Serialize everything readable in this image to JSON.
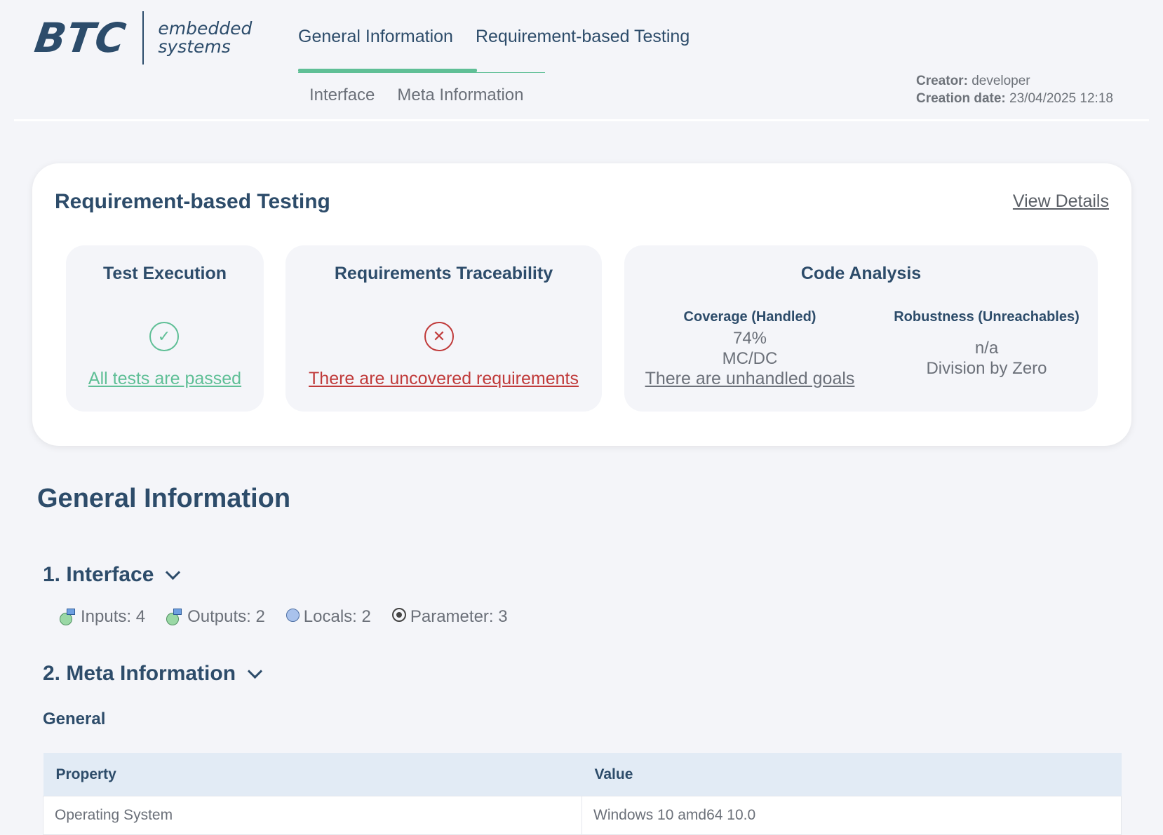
{
  "header": {
    "logo_brand": "BTC",
    "logo_line1": "embedded",
    "logo_line2": "systems",
    "nav_top": [
      "General Information",
      "Requirement-based Testing"
    ],
    "nav_sub": [
      "Interface",
      "Meta Information"
    ],
    "creator_label": "Creator:",
    "creator_value": "developer",
    "date_label": "Creation date:",
    "date_value": "23/04/2025 12:18"
  },
  "rbt": {
    "title": "Requirement-based Testing",
    "view_details": "View Details",
    "test_execution": {
      "title": "Test Execution",
      "status": "ok",
      "link": "All tests are passed"
    },
    "traceability": {
      "title": "Requirements Traceability",
      "status": "error",
      "link": "There are uncovered requirements"
    },
    "code_analysis": {
      "title": "Code Analysis",
      "coverage_title": "Coverage (Handled)",
      "coverage_value": "74%",
      "coverage_metric": "MC/DC",
      "coverage_link": "There are unhandled goals",
      "robustness_title": "Robustness (Unreachables)",
      "robustness_value": "n/a",
      "robustness_metric": "Division by Zero"
    },
    "colors": {
      "ok": "#5fbf96",
      "error": "#c03a3a",
      "heading": "#2d4c6a"
    }
  },
  "general": {
    "title": "General Information",
    "interface_heading": "1. Interface",
    "interface_items": [
      {
        "icon": "input-icon",
        "label": "Inputs: 4"
      },
      {
        "icon": "output-icon",
        "label": "Outputs: 2"
      },
      {
        "icon": "local-icon",
        "label": "Locals: 2"
      },
      {
        "icon": "parameter-icon",
        "label": "Parameter: 3"
      }
    ],
    "meta_heading": "2. Meta Information",
    "meta_sub": "General",
    "table_headers": [
      "Property",
      "Value"
    ],
    "table_rows": [
      [
        "Operating System",
        "Windows 10 amd64 10.0"
      ]
    ]
  }
}
